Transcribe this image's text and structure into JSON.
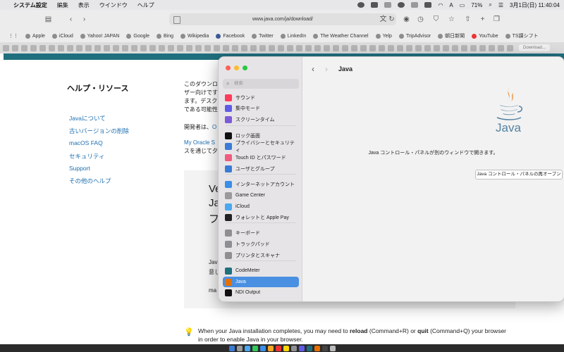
{
  "menubar": {
    "app_name": "システム設定",
    "items": [
      "編集",
      "表示",
      "ウインドウ",
      "ヘルプ"
    ],
    "battery": "71%",
    "input_mode": "A",
    "datetime": "3月1日(日)  11:40:04"
  },
  "browser": {
    "url": "www.java.com/ja/download/",
    "bookmarks": [
      "Apple",
      "iCloud",
      "Yahoo! JAPAN",
      "Google",
      "Bing",
      "Wikipedia",
      "Facebook",
      "Twitter",
      "LinkedIn",
      "The Weather Channel",
      "Yelp",
      "TripAdvisor",
      "朝日新聞",
      "YouTube",
      "TS課シフト"
    ],
    "current_tab": "Download..."
  },
  "page": {
    "help_title": "ヘルプ・リソース",
    "help_links": [
      "Javaについて",
      "古いバージョンの削除",
      "macOS FAQ",
      "セキュリティ",
      "Support",
      "その他のヘルプ"
    ],
    "body_lines": [
      "このダウンロ",
      "ザー向けです",
      "ます。デスク",
      "である可能性"
    ],
    "dev_text": "開発者は、",
    "dev_link": "O",
    "oracle_link": "My Oracle S",
    "oracle_text": "スを通じて夕",
    "box_big": [
      "Ve",
      "Ja",
      "フ"
    ],
    "box_small": [
      "Jav",
      "意し"
    ],
    "box_ma": "ma",
    "note_prefix": "When your Java installation completes, you may need to ",
    "note_reload": "reload",
    "note_mid": " (Command+R) or ",
    "note_quit": "quit",
    "note_suffix": " (Command+Q) your browser in order to enable Java in your browser."
  },
  "settings": {
    "search_placeholder": "検索",
    "sidebar_items": [
      {
        "label": "サウンド",
        "color": "#ff3b5c"
      },
      {
        "label": "集中モード",
        "color": "#5e5ce6"
      },
      {
        "label": "スクリーンタイム",
        "color": "#7d5bd6"
      },
      {
        "label": "ロック画面",
        "color": "#111111"
      },
      {
        "label": "プライバシーとセキュリティ",
        "color": "#3a7bd5"
      },
      {
        "label": "Touch ID とパスワード",
        "color": "#f05c7e"
      },
      {
        "label": "ユーザとグループ",
        "color": "#3a7bd5"
      },
      {
        "label": "インターネットアカウント",
        "color": "#3a8ee6"
      },
      {
        "label": "Game Center",
        "color": "#9a9a9a"
      },
      {
        "label": "iCloud",
        "color": "#4aa8f0"
      },
      {
        "label": "ウォレットと Apple Pay",
        "color": "#222222"
      },
      {
        "label": "キーボード",
        "color": "#8e8e93"
      },
      {
        "label": "トラックパッド",
        "color": "#8e8e93"
      },
      {
        "label": "プリンタとスキャナ",
        "color": "#8e8e93"
      },
      {
        "label": "CodeMeter",
        "color": "#1f6f7e"
      },
      {
        "label": "Java",
        "color": "#e76f00"
      },
      {
        "label": "NDI Output",
        "color": "#111111"
      }
    ],
    "selected_item": "Java",
    "pane_title": "Java",
    "logo_text": "Java",
    "pane_message": "Java コントロール・パネルが別のウィンドウで開きます。",
    "reopen_button": "Java コントロール・パネルの再オープン"
  },
  "colors": {
    "accent": "#4a90e2",
    "link": "#1b6eb0",
    "java_orange": "#e76f00",
    "java_blue": "#5382a1",
    "teal": "#1f6f7e"
  }
}
